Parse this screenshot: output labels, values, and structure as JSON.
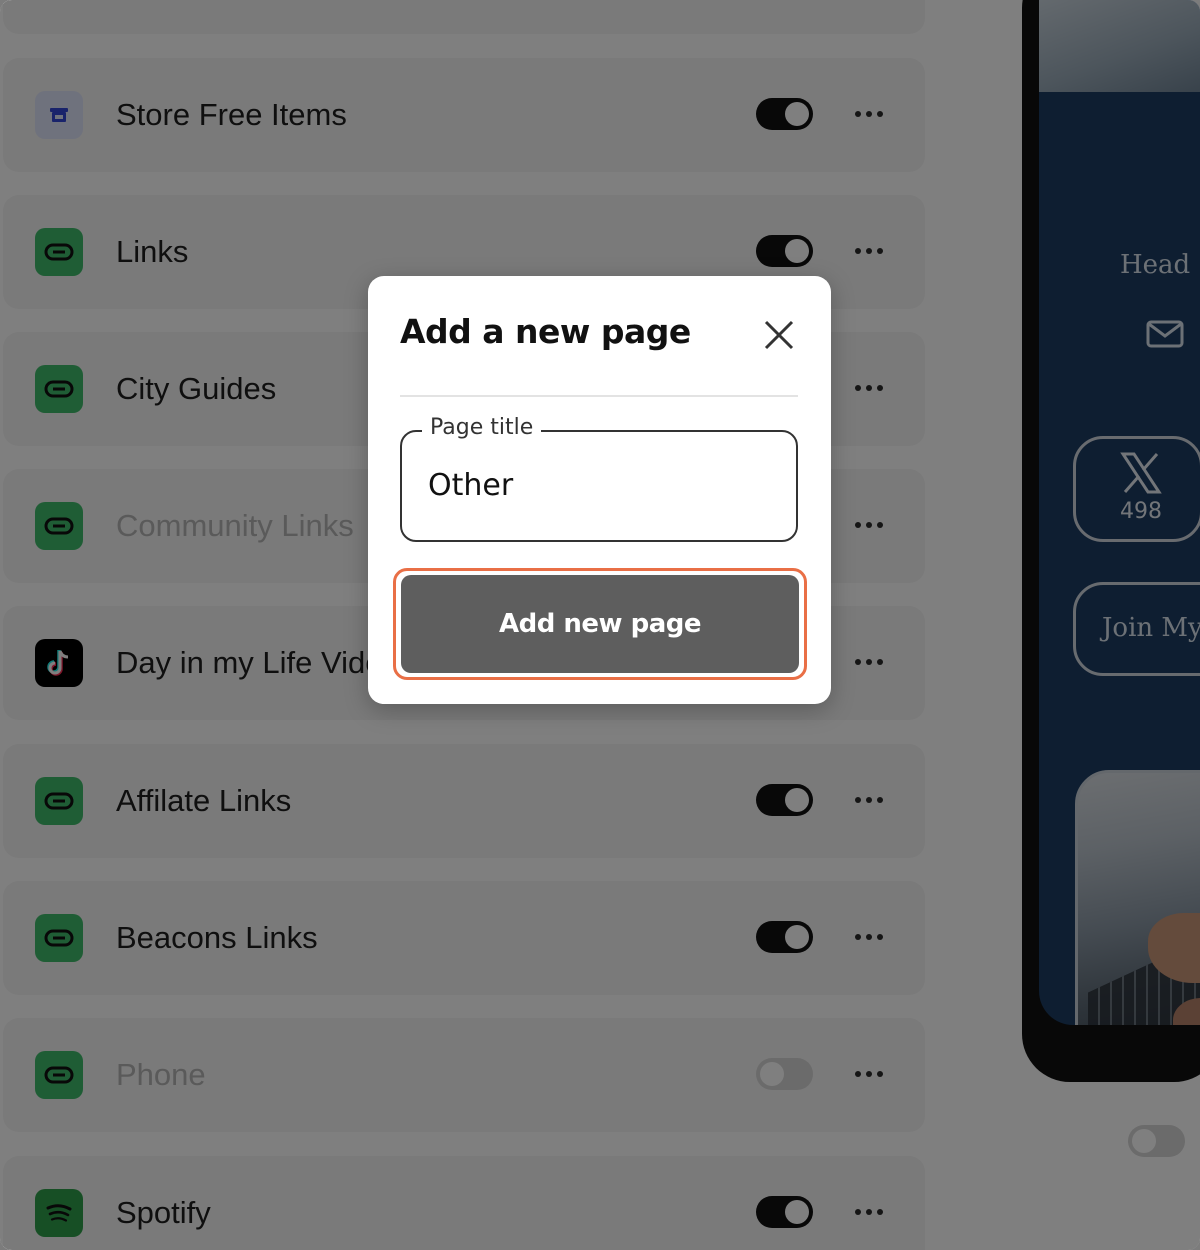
{
  "list": {
    "items": [
      {
        "label": "Store Free Items",
        "icon": "store-icon",
        "enabled": true
      },
      {
        "label": "Links",
        "icon": "link-icon",
        "enabled": true
      },
      {
        "label": "City Guides",
        "icon": "link-icon",
        "enabled": true
      },
      {
        "label": "Community Links",
        "icon": "link-icon",
        "enabled": false
      },
      {
        "label": "Day in my Life Videos",
        "icon": "tiktok-icon",
        "enabled": true
      },
      {
        "label": "Affilate Links",
        "icon": "link-icon",
        "enabled": true
      },
      {
        "label": "Beacons Links",
        "icon": "link-icon",
        "enabled": true
      },
      {
        "label": "Phone",
        "icon": "link-icon",
        "enabled": false
      },
      {
        "label": "Spotify",
        "icon": "spotify-icon",
        "enabled": true
      }
    ]
  },
  "preview": {
    "heading": "Head",
    "twitter_count": "498",
    "join_label": "Join My"
  },
  "modal": {
    "title": "Add a new page",
    "field_label": "Page title",
    "field_value": "Other",
    "submit_label": "Add new page"
  },
  "colors": {
    "overlay": "#000000",
    "highlight": "#e96f46",
    "link_icon_bg": "#3fbb6a",
    "button_bg": "#5e5e5e"
  }
}
